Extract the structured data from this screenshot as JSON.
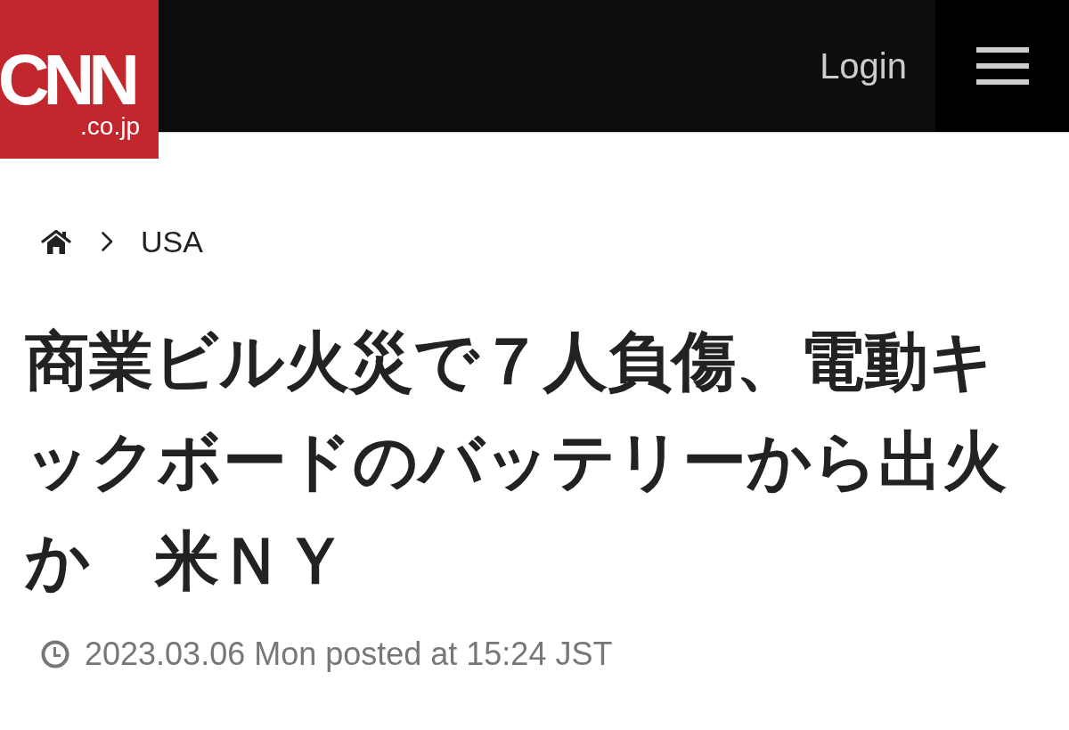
{
  "header": {
    "logo": {
      "wordmark": "CNN",
      "domain": ".co.jp"
    },
    "login": "Login"
  },
  "breadcrumb": {
    "items": [
      {
        "label": "USA"
      }
    ]
  },
  "article": {
    "headline": "商業ビル火災で７人負傷、電動キックボードのバッテリーから出火か　米ＮＹ",
    "published": "2023.03.06 Mon posted at 15:24 JST"
  }
}
